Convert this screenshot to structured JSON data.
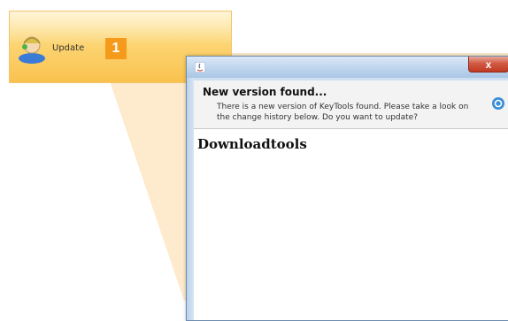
{
  "toolbar": {
    "update_label": "Update",
    "step_number": "1",
    "avatar_icon": "user-update-icon"
  },
  "dialog": {
    "close_label": "x",
    "app_icon": "java-icon",
    "header_title": "New version found...",
    "header_description": "There is a new version of KeyTools found. Please take a look on the change history below. Do you want to update?",
    "header_icon": "info-icon",
    "content_title": "Downloadtools"
  },
  "colors": {
    "toolbar_gradient_top": "#fde9a8",
    "toolbar_gradient_bottom": "#f9c24e",
    "badge": "#f59a1a",
    "titlebar": "#bcd3ec",
    "close_button": "#c03a22"
  }
}
